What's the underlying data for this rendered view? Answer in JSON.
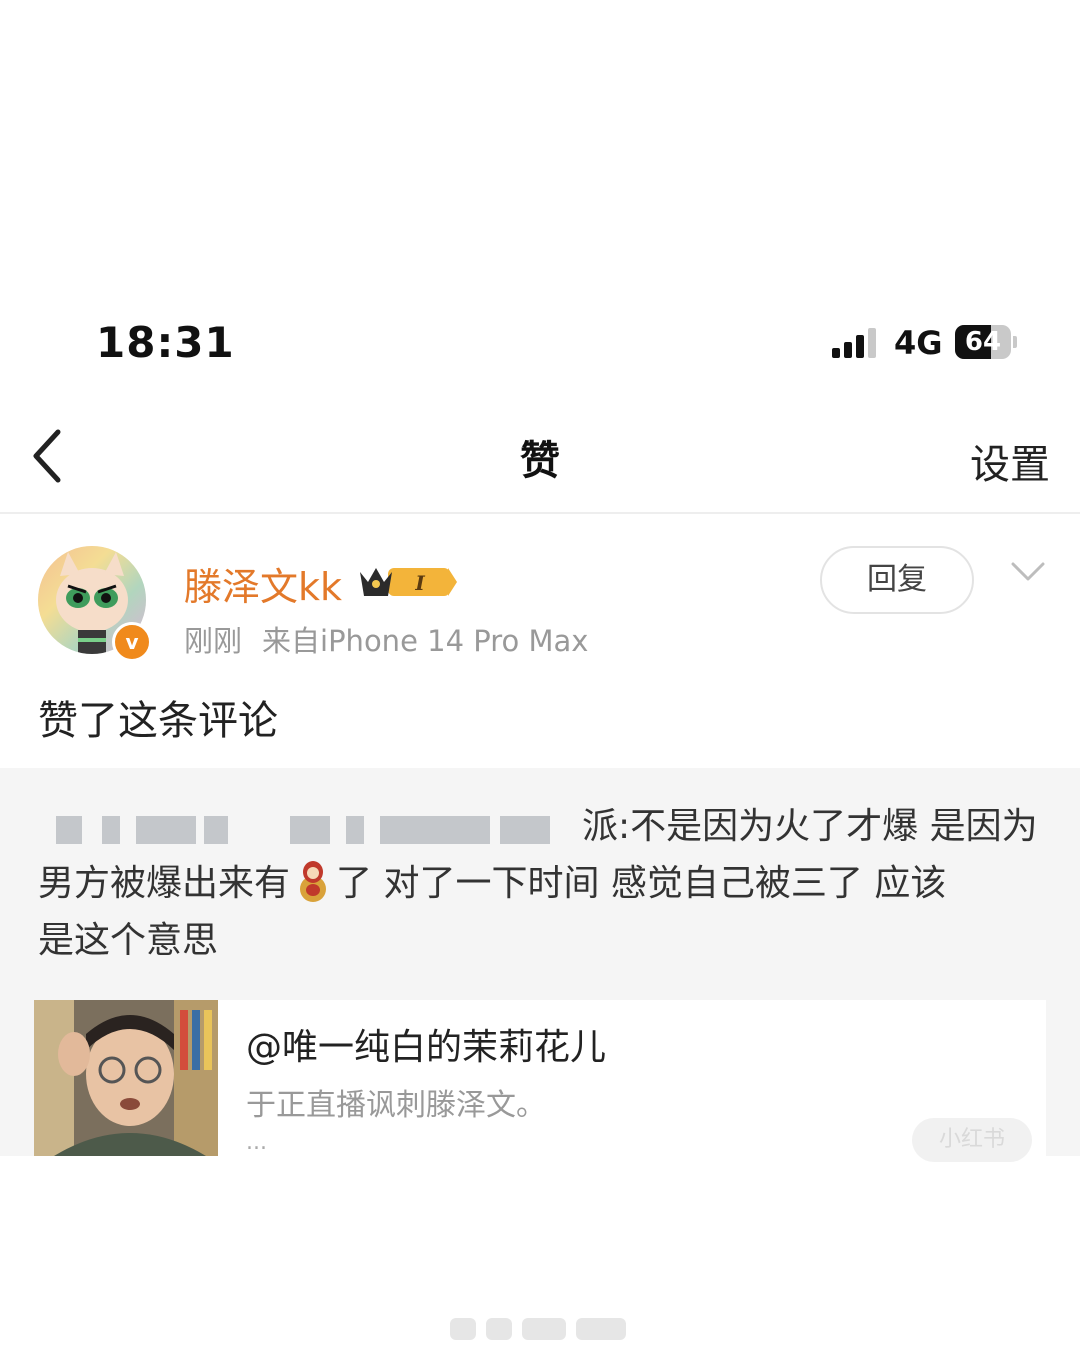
{
  "status_bar": {
    "time": "18:31",
    "network": "4G",
    "battery": 64
  },
  "nav": {
    "title": "赞",
    "settings_label": "设置"
  },
  "notification": {
    "username": "滕泽文kk",
    "vip_level": "I",
    "time": "刚刚",
    "source": "来自iPhone 14 Pro Max",
    "reply_label": "回复",
    "action": "赞了这条评论",
    "comment_visible_prefix": "派:不是因为火了才爆 是因为",
    "comment_line2a": "男方被爆出来有",
    "comment_line2b": "了 对了一下时间 感觉自己被三了 应该",
    "comment_line3": "是这个意思"
  },
  "card": {
    "title": "@唯一纯白的茉莉花儿",
    "desc": "于正直播讽刺滕泽文。",
    "more": "...",
    "watermark": "小红书"
  },
  "colors": {
    "accent_orange": "#e3792a",
    "verified_badge": "#f08a1c",
    "gray_text": "#999999"
  },
  "icons": {
    "back": "chevron-left-icon",
    "dropdown": "chevron-down-icon",
    "verified": "verified-v-icon",
    "vip": "crown-vip-icon",
    "emoji": "matryoshka-doll-icon"
  }
}
